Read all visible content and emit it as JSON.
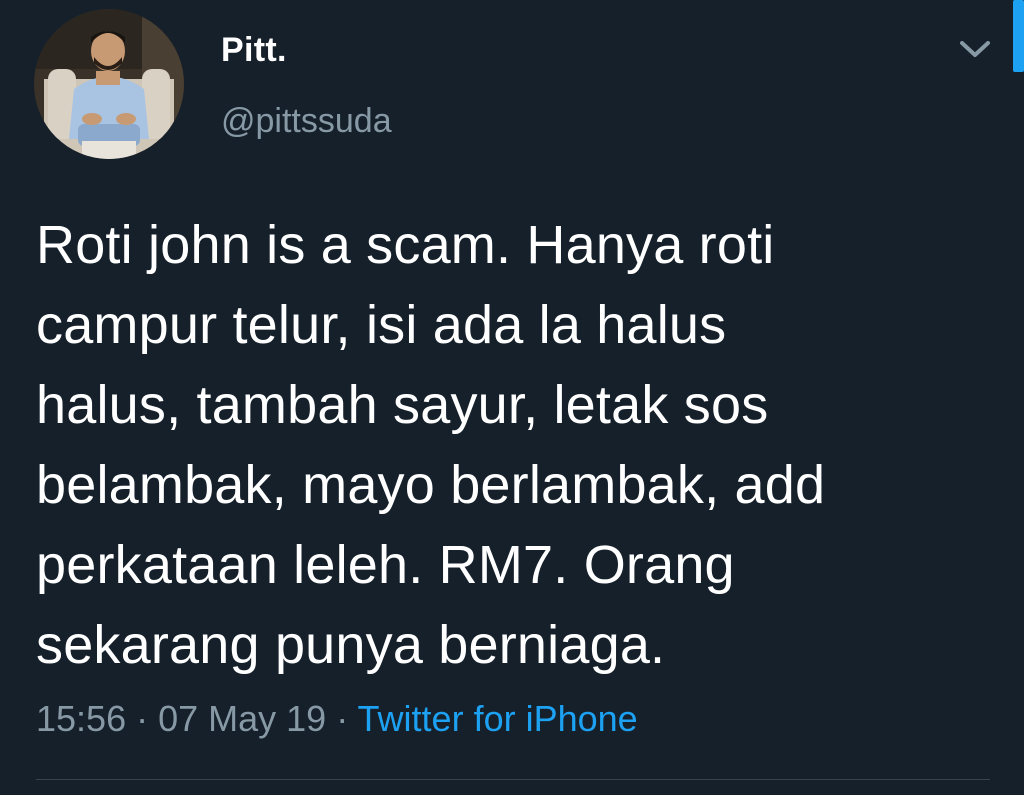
{
  "tweet": {
    "display_name": "Pitt.",
    "handle": "@pittssuda",
    "text": "Roti john is a scam. Hanya roti\ncampur telur, isi ada la halus\nhalus, tambah sayur, letak sos\nbelambak, mayo berlambak, add\nperkataan leleh. RM7. Orang\nsekarang punya berniaga.",
    "time": "15:56",
    "date": "07 May 19",
    "separator": " · ",
    "source": "Twitter for iPhone"
  },
  "icons": {
    "menu": "chevron-down-icon"
  },
  "colors": {
    "background": "#15202b",
    "text": "#ffffff",
    "secondary_text": "#8899a6",
    "accent": "#1da1f2",
    "divider": "#38444d"
  }
}
